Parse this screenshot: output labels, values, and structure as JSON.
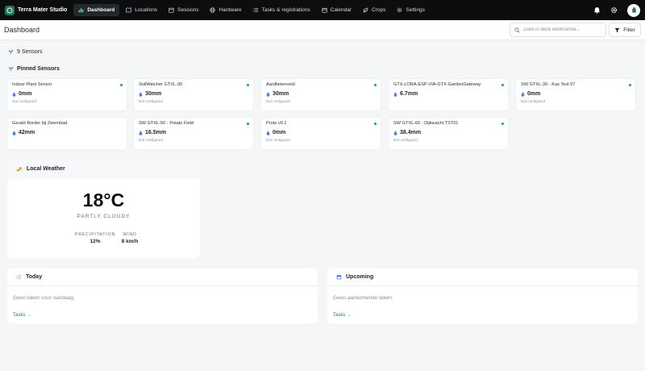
{
  "app": {
    "brand": "Terra Mater Studio"
  },
  "nav": [
    {
      "label": "Dashboard",
      "icon": "bar-chart-icon",
      "active": true
    },
    {
      "label": "Locations",
      "icon": "map-icon"
    },
    {
      "label": "Sessions",
      "icon": "calendar-grid-icon"
    },
    {
      "label": "Hardware",
      "icon": "globe-icon"
    },
    {
      "label": "Tasks & registrations",
      "icon": "list-icon"
    },
    {
      "label": "Calendar",
      "icon": "calendar-icon"
    },
    {
      "label": "Crops",
      "icon": "leaf-icon"
    },
    {
      "label": "Settings",
      "icon": "gear-icon"
    }
  ],
  "header": {
    "title": "Dashboard",
    "search_placeholder": "Zoek in deze werkruimte...",
    "filter_label": "Filter"
  },
  "sensors_count_label": "9 Sensors",
  "pinned_title": "Pinned Sensors",
  "sensors": [
    {
      "name": "Indoor Plant Sensor",
      "value": "0mm",
      "status": "Not configured"
    },
    {
      "name": "SoilWatcher GTXL-30",
      "value": "30mm",
      "status": "Not configured"
    },
    {
      "name": "Aardbeienveld",
      "value": "30mm",
      "status": "Not configured"
    },
    {
      "name": "GTX-LORA-ESP-VIA-GTX-GardenGateway",
      "value": "6.7mm",
      "status": ""
    },
    {
      "name": "SW GTXL-30 - Kas Test 07",
      "value": "0mm",
      "status": "Not configured"
    },
    {
      "name": "Gerald Border bij Zwembad",
      "value": "42mm",
      "status": ""
    },
    {
      "name": "SW GTXL-50 - Potato Field",
      "value": "16.5mm",
      "status": "Not configured"
    },
    {
      "name": "Proto v0.1",
      "value": "0mm",
      "status": "Not configured"
    },
    {
      "name": "SW GTXL-60 - Dijkwacht TST01",
      "value": "38.4mm",
      "status": "Not configured"
    }
  ],
  "weather": {
    "title": "Local Weather",
    "temp": "18°C",
    "condition": "PARTLY CLOUDY",
    "precip_label": "PRECIPITATION",
    "precip_value": "12%",
    "wind_label": "WIND",
    "wind_value": "8 km/h"
  },
  "today": {
    "title": "Today",
    "empty": "Geen taken voor vandaag.",
    "link": "Tasks →"
  },
  "upcoming": {
    "title": "Upcoming",
    "empty": "Geen aankomende taken.",
    "link": "Tasks →"
  },
  "colors": {
    "accent": "#1f7a5a",
    "status_dot": "#22a06b",
    "drop": "#3b82f6"
  }
}
